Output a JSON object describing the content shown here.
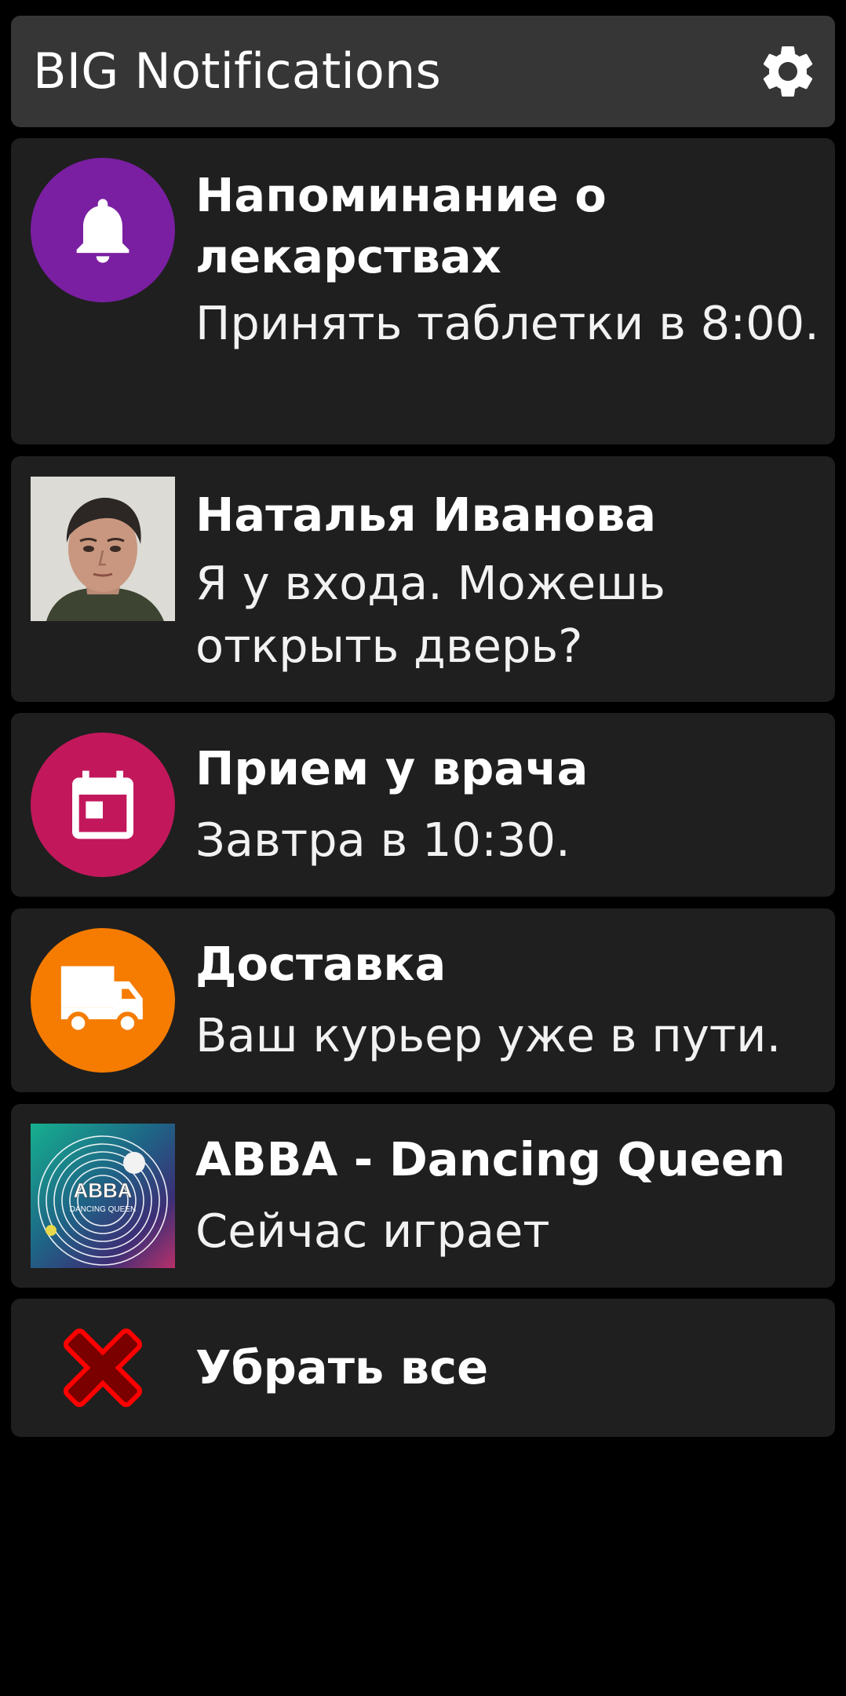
{
  "header": {
    "title": "BIG Notifications",
    "settings_icon": "gear-icon"
  },
  "notifications": [
    {
      "icon": "bell-icon",
      "icon_color": "#7a1fa2",
      "title": "Напоминание о лекарствах",
      "body": "Принять таблетки в 8:00."
    },
    {
      "icon": "contact-photo",
      "title": "Наталья Иванова",
      "body": "Я у входа. Можешь открыть дверь?"
    },
    {
      "icon": "calendar-icon",
      "icon_color": "#c2185b",
      "title": "Прием у врача",
      "body": "Завтра в 10:30."
    },
    {
      "icon": "truck-icon",
      "icon_color": "#f57c00",
      "title": "Доставка",
      "body": "Ваш курьер уже в пути."
    },
    {
      "icon": "album-art",
      "album_text": "ABBA",
      "album_subtext": "DANCING QUEEN",
      "title": "ABBA - Dancing Queen",
      "body": "Сейчас играет"
    }
  ],
  "clear_all": {
    "icon": "close-icon",
    "icon_color": "#e00000",
    "label": "Убрать все"
  },
  "colors": {
    "background": "#000000",
    "card": "#1f1f1f",
    "header": "#363636",
    "text": "#ffffff"
  }
}
